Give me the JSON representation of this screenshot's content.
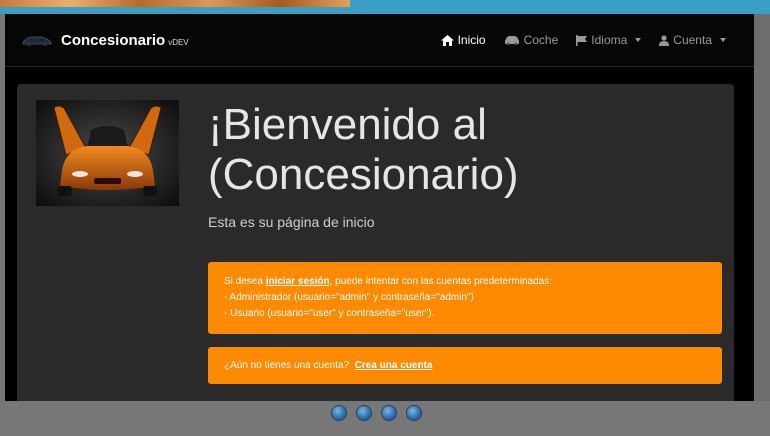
{
  "navbar": {
    "brand": "Concesionario",
    "version": "vDEV",
    "items": [
      {
        "label": "Inicio",
        "icon": "home-icon",
        "active": true
      },
      {
        "label": "Coche",
        "icon": "car-icon",
        "active": false
      },
      {
        "label": "Idioma",
        "icon": "flag-icon",
        "active": false
      },
      {
        "label": "Cuenta",
        "icon": "user-icon",
        "active": false
      }
    ]
  },
  "hero": {
    "title_line1": "¡Bienvenido al",
    "title_line2": "(Concesionario)",
    "lead": "Esta es su página de inicio"
  },
  "alert1": {
    "prefix": "Si desea ",
    "link": "iniciar sesión",
    "suffix": ", puede intentar con las cuentas predeterminadas:",
    "line2": "- Administrador (usuario=\"admin\" y contraseña=\"admin\")",
    "line3": "- Usuario (usuario=\"user\" y contraseña=\"user\")."
  },
  "alert2": {
    "text": "¿Aún no tienes una cuenta?",
    "link": "Crea una cuenta"
  },
  "colors": {
    "accent": "#fd8a00",
    "navbar": "#060606",
    "panel": "#2a2a2a"
  }
}
